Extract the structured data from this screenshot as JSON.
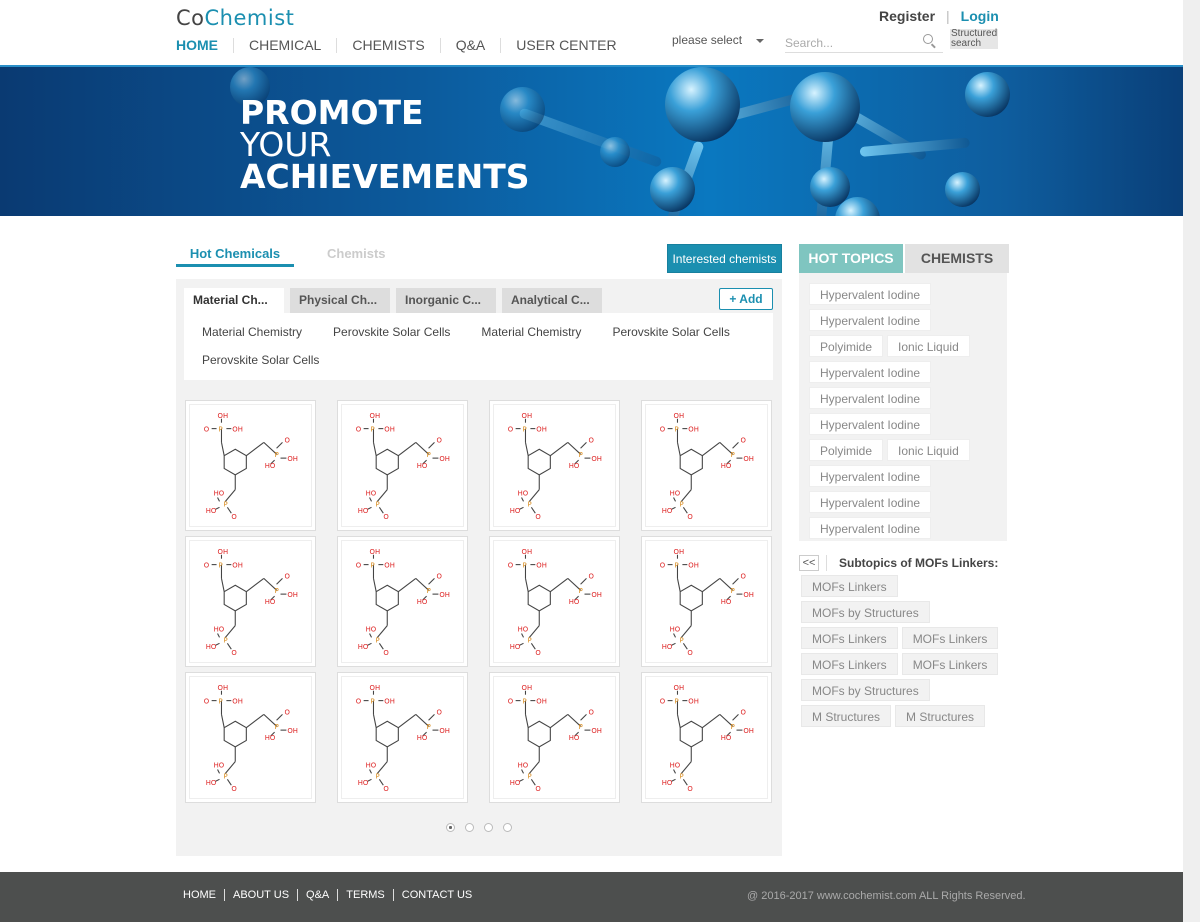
{
  "header": {
    "logo_co": "Co",
    "logo_chemist": "Chemist",
    "nav": [
      "HOME",
      "CHEMICAL",
      "CHEMISTS",
      "Q&A",
      "USER CENTER"
    ],
    "register": "Register",
    "separator": "|",
    "login": "Login",
    "select_value": "please select",
    "search_placeholder": "Search...",
    "structured_search": "Structured search"
  },
  "banner": {
    "line1": "PROMOTE",
    "line2": "YOUR",
    "line3": "ACHIEVEMENTS"
  },
  "main": {
    "tab_active": "Hot Chemicals",
    "tab_inactive": "Chemists",
    "interested_button": "Interested chemists",
    "category_tabs": [
      "Material Ch...",
      "Physical Ch...",
      "Inorganic C...",
      "Analytical C..."
    ],
    "add_button": "+ Add",
    "subtopics": [
      "Material Chemistry",
      "Perovskite Solar Cells",
      "Material Chemistry",
      "Perovskite Solar Cells",
      "Perovskite Solar Cells"
    ],
    "molecule_labels": {
      "oh": "OH",
      "ho": "HO",
      "o": "O",
      "p": "P"
    },
    "pages": 4,
    "current_page": 1
  },
  "sidebar": {
    "tab_hot": "HOT TOPICS",
    "tab_chemists": "CHEMISTS",
    "hot_topics": [
      [
        "Hypervalent Iodine"
      ],
      [
        "Hypervalent Iodine"
      ],
      [
        "Polyimide",
        "Ionic Liquid"
      ],
      [
        "Hypervalent Iodine"
      ],
      [
        "Hypervalent Iodine"
      ],
      [
        "Hypervalent Iodine"
      ],
      [
        "Polyimide",
        "Ionic Liquid"
      ],
      [
        "Hypervalent Iodine"
      ],
      [
        "Hypervalent Iodine"
      ],
      [
        "Hypervalent Iodine"
      ]
    ],
    "back_button": "<<",
    "subtopics_title": "Subtopics of MOFs Linkers:",
    "mof_topics": [
      [
        "MOFs Linkers"
      ],
      [
        "MOFs by Structures"
      ],
      [
        "MOFs Linkers",
        "MOFs Linkers"
      ],
      [
        "MOFs Linkers",
        "MOFs Linkers"
      ],
      [
        "MOFs by Structures"
      ],
      [
        "M Structures",
        "M Structures"
      ]
    ]
  },
  "footer": {
    "links": [
      "HOME",
      "ABOUT US",
      "Q&A",
      "TERMS",
      "CONTACT US"
    ],
    "copyright": "@ 2016-2017 www.cochemist.com ALL Rights Reserved."
  },
  "colors": {
    "accent": "#1b8fb0",
    "hot_tab": "#7fc5c0",
    "footer": "#4d4f4e"
  }
}
